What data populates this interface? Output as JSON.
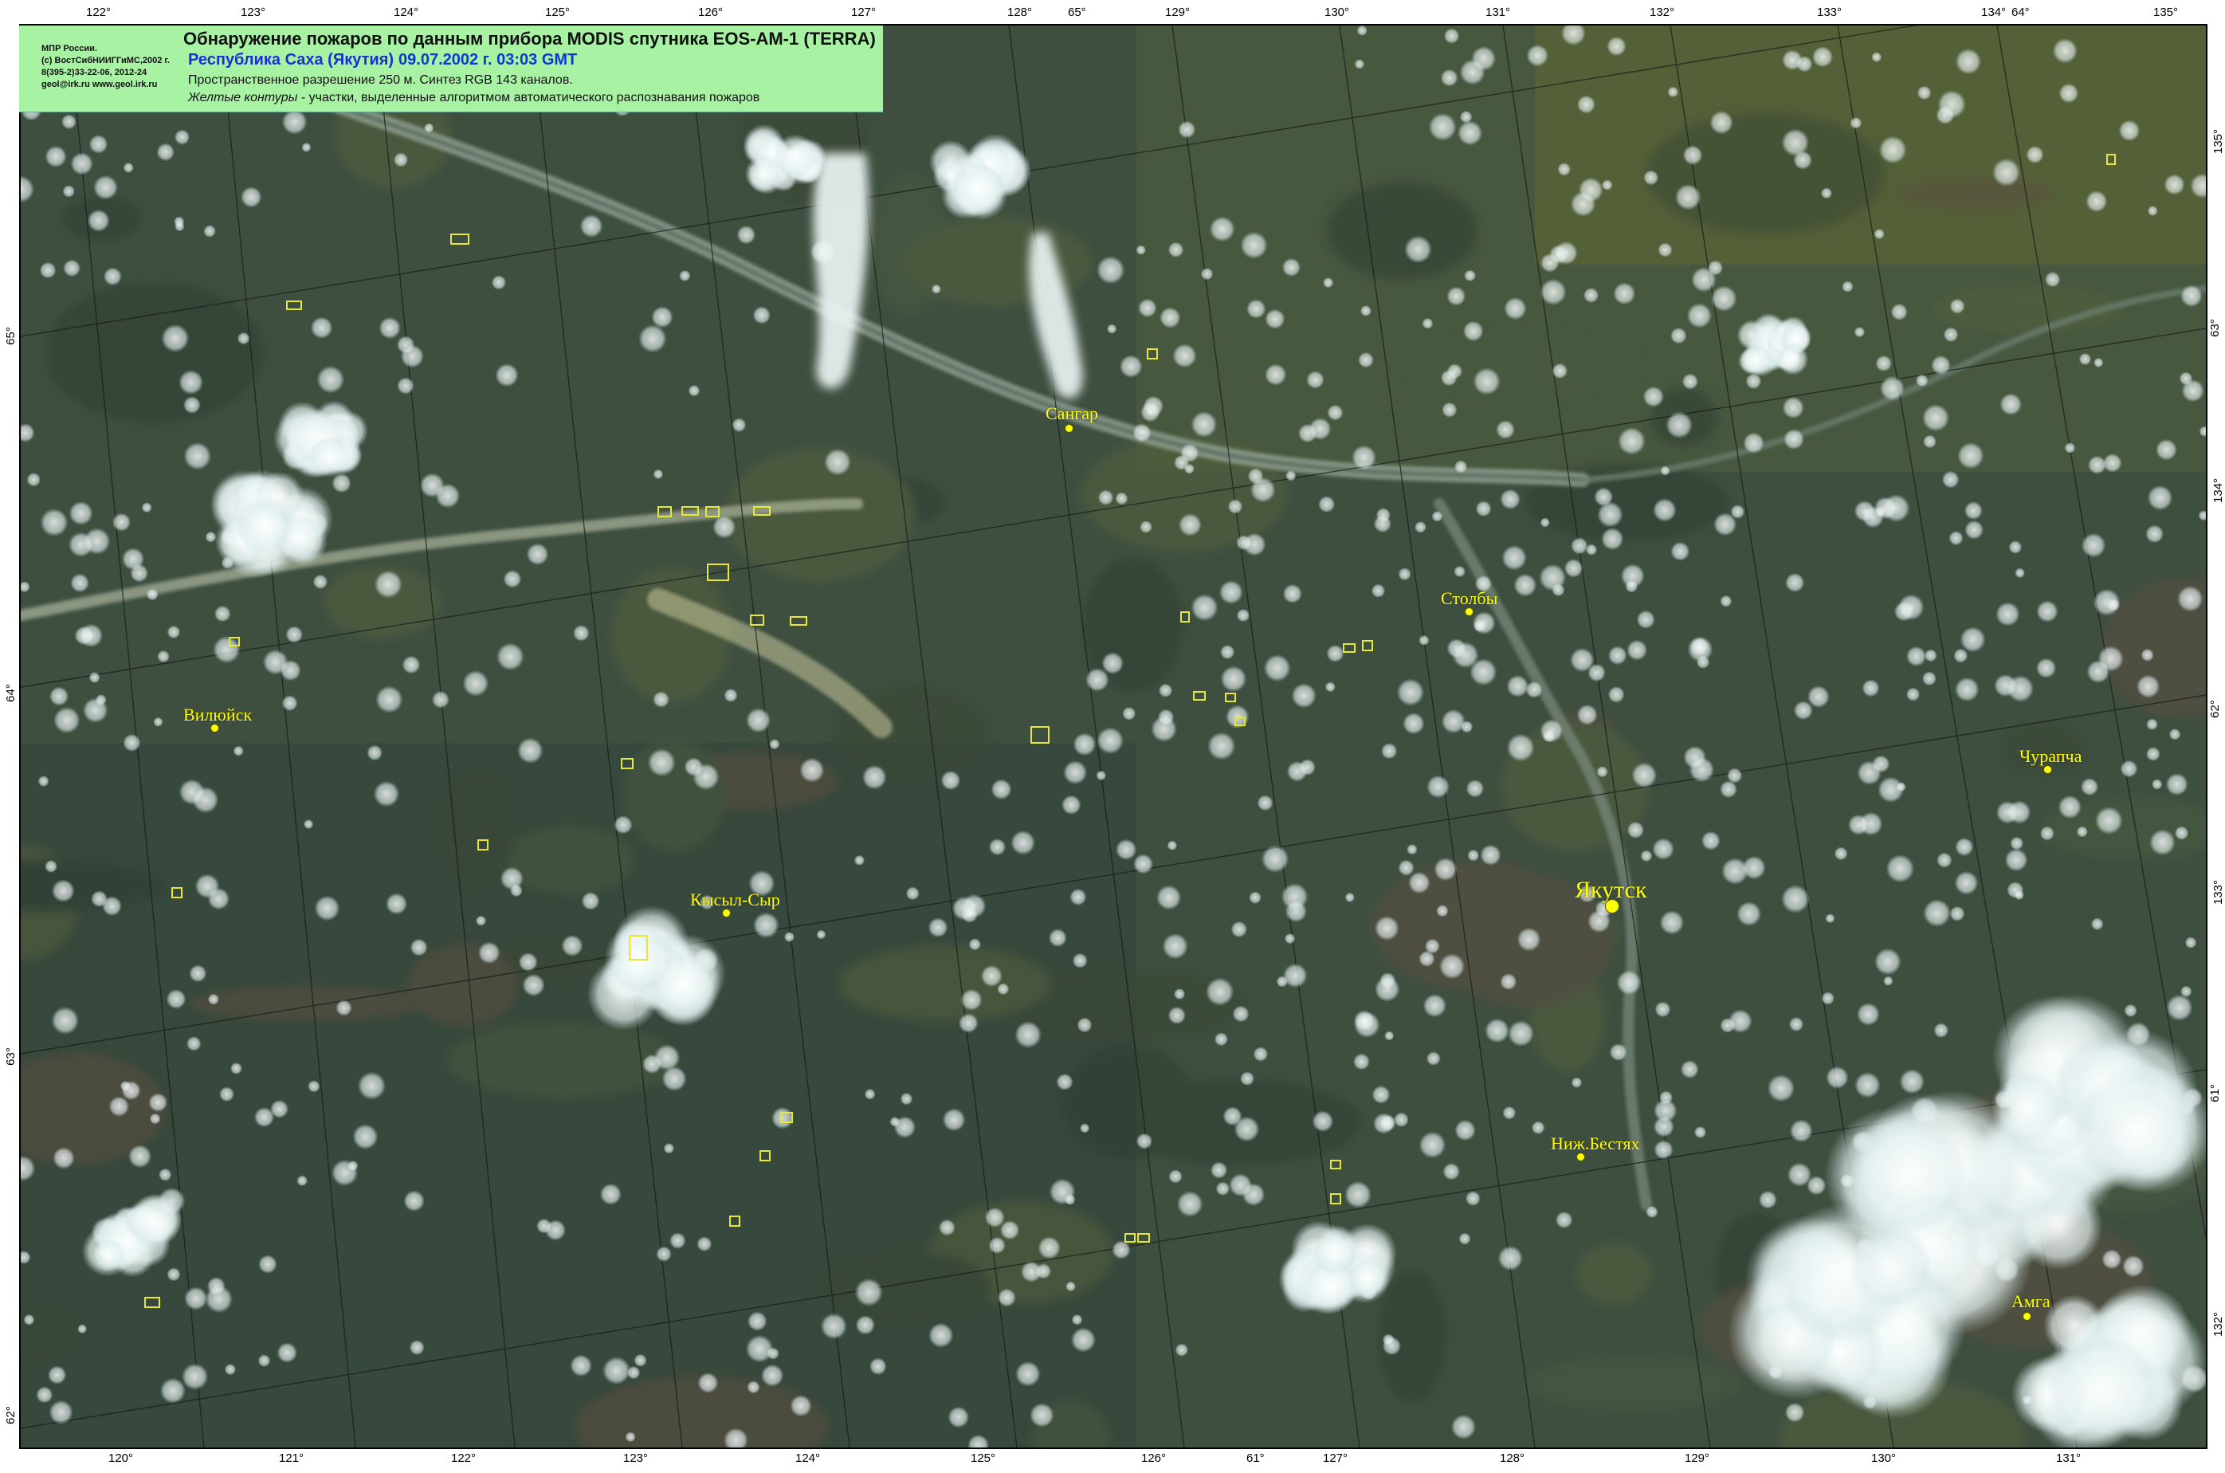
{
  "header": {
    "credits": [
      "МПР России.",
      "(c) ВостСибНИИГГиМС,2002 г.",
      "8(395-2)33-22-06, 2012-24",
      "geol@irk.ru  www.geol.irk.ru"
    ],
    "title": "Обнаружение пожаров по данным прибора MODIS спутника EOS-AM-1 (TERRA)",
    "region": "Республика Саха (Якутия)",
    "date": "09.07.2002 г. 03:03 GMT",
    "resolution": "Пространственное разрешение 250 м. Синтез RGB 143 каналов.",
    "contours_label": "Желтые контуры",
    "contours_text": " - участки, выделенные алгоритмом автоматического распознавания пожаров"
  },
  "colors": {
    "header_bg": "#a8f2a4",
    "region": "#1a2ed6",
    "town": "#ffff00",
    "fire_contour": "#e8e830"
  },
  "graticule": {
    "top": [
      "122°",
      "123°",
      "124°",
      "125°",
      "126°",
      "127°",
      "128°",
      "65°",
      "129°",
      "130°",
      "131°",
      "132°",
      "133°",
      "134°",
      "64°",
      "135°"
    ],
    "bottom": [
      "120°",
      "121°",
      "122°",
      "123°",
      "124°",
      "125°",
      "126°",
      "61°",
      "127°",
      "128°",
      "129°",
      "130°",
      "131°"
    ],
    "left": [
      "65°",
      "64°",
      "63°",
      "62°"
    ],
    "right": [
      "135°",
      "63°",
      "134°",
      "62°",
      "133°",
      "61°",
      "132°"
    ]
  },
  "towns": [
    {
      "name": "Сангар"
    },
    {
      "name": "Столбы"
    },
    {
      "name": "Вилюйск"
    },
    {
      "name": "Чурапча"
    },
    {
      "name": "Кысыл-Сыр"
    },
    {
      "name": "Якутск"
    },
    {
      "name": "Ниж.Бестях"
    },
    {
      "name": "Амга"
    }
  ]
}
